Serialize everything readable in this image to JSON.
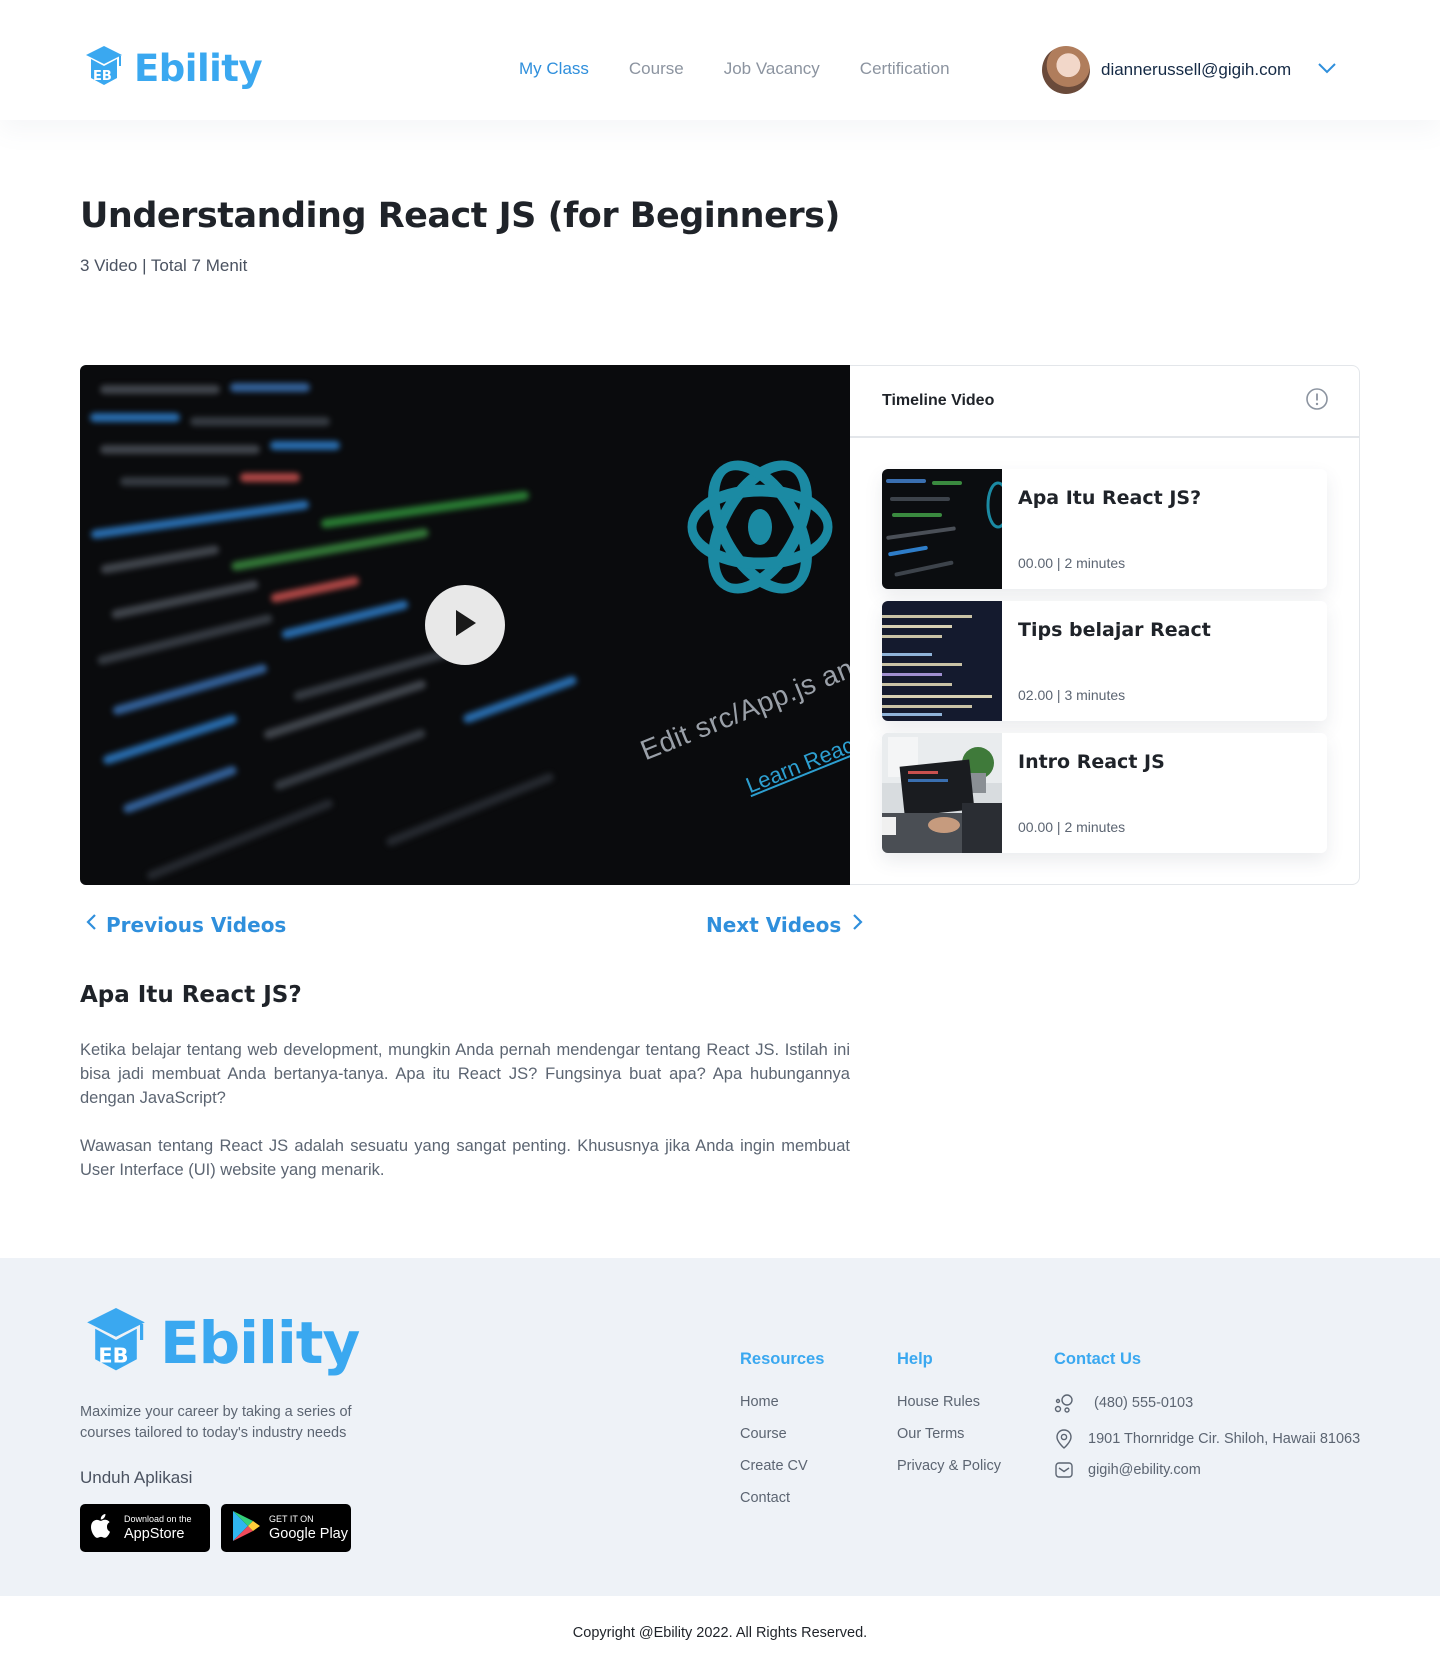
{
  "header": {
    "logo": "Ebility",
    "nav": [
      {
        "label": "My Class",
        "active": true
      },
      {
        "label": "Course",
        "active": false
      },
      {
        "label": "Job Vacancy",
        "active": false
      },
      {
        "label": "Certification",
        "active": false
      }
    ],
    "user_email": "diannerussell@gigih.com"
  },
  "course": {
    "title": "Understanding React JS (for Beginners)",
    "meta": "3 Video | Total 7 Menit"
  },
  "player": {
    "overlay_text": "Edit src/App.js and save to",
    "overlay_link": "Learn React"
  },
  "timeline": {
    "title": "Timeline Video",
    "items": [
      {
        "title": "Apa Itu React JS?",
        "meta": "00.00  |  2 minutes"
      },
      {
        "title": "Tips belajar React",
        "meta": "02.00  |  3 minutes"
      },
      {
        "title": "Intro React JS",
        "meta": "00.00  |  2 minutes"
      }
    ]
  },
  "pager": {
    "prev": "Previous Videos",
    "next": "Next Videos"
  },
  "article": {
    "title": "Apa Itu React JS?",
    "paragraphs": [
      "Ketika belajar tentang web development, mungkin Anda pernah mendengar tentang React JS. Istilah ini bisa jadi membuat Anda bertanya-tanya. Apa itu React JS? Fungsinya buat apa? Apa hubungannya dengan JavaScript?",
      "Wawasan tentang React JS adalah sesuatu yang sangat penting. Khususnya jika Anda ingin membuat User Interface (UI) website yang menarik."
    ]
  },
  "footer": {
    "logo": "Ebility",
    "tagline": "Maximize your career by taking a series of courses tailored to today's industry needs",
    "download_label": "Unduh Aplikasi",
    "appstore": {
      "small": "Download on the",
      "big": "AppStore"
    },
    "googleplay": {
      "small": "GET IT ON",
      "big": "Google Play"
    },
    "resources": {
      "title": "Resources",
      "links": [
        "Home",
        "Course",
        "Create CV",
        "Contact"
      ]
    },
    "help": {
      "title": "Help",
      "links": [
        "House Rules",
        "Our Terms",
        "Privacy & Policy"
      ]
    },
    "contact": {
      "title": "Contact Us",
      "phone": "(480) 555-0103",
      "address": "1901 Thornridge Cir. Shiloh, Hawaii 81063",
      "email": "gigih@ebility.com"
    },
    "copyright": "Copyright @Ebility 2022. All Rights Reserved."
  },
  "colors": {
    "brand": "#3aa8f0",
    "link": "#2f8fdc",
    "footer_bg": "#eef2f7"
  }
}
